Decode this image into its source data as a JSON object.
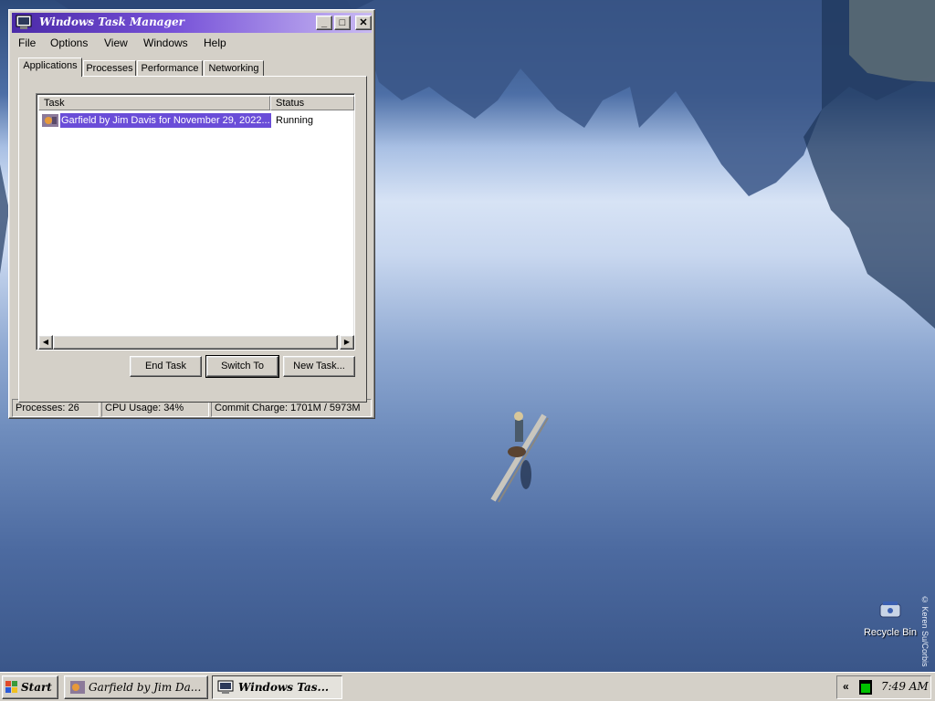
{
  "window": {
    "title": "Windows Task Manager",
    "controls": {
      "minimize": "_",
      "maximize": "□",
      "close": "✕"
    },
    "menu": [
      "File",
      "Options",
      "View",
      "Windows",
      "Help"
    ],
    "tabs": [
      "Applications",
      "Processes",
      "Performance",
      "Networking"
    ],
    "active_tab": "Applications",
    "columns": {
      "task": "Task",
      "status": "Status"
    },
    "tasks": [
      {
        "name": "Garfield by Jim Davis for November 29, 2022...",
        "status": "Running",
        "icon": "garfield-app-icon"
      }
    ],
    "buttons": {
      "end_task": "End Task",
      "switch_to": "Switch To",
      "new_task": "New Task..."
    },
    "status_bar": {
      "processes": "Processes: 26",
      "cpu": "CPU Usage: 34%",
      "commit": "Commit Charge: 1701M / 5973M"
    }
  },
  "desktop": {
    "icons": [
      {
        "label": "Recycle Bin",
        "icon": "recycle-bin-icon"
      }
    ],
    "wallpaper_credit": "© Keren Su/Corbis"
  },
  "taskbar": {
    "start_label": "Start",
    "buttons": [
      {
        "label": "Garfield by Jim Da...",
        "icon": "garfield-app-icon",
        "pressed": false
      },
      {
        "label": "Windows Tas...",
        "icon": "task-manager-icon",
        "pressed": true
      }
    ],
    "tray": {
      "expand": "«",
      "clock": "7:49 AM"
    }
  },
  "colors": {
    "title_gradient_start": "#4b2aa8",
    "title_gradient_end": "#c9baf3",
    "selection": "#6a4dd8",
    "face": "#d4d0c8"
  }
}
